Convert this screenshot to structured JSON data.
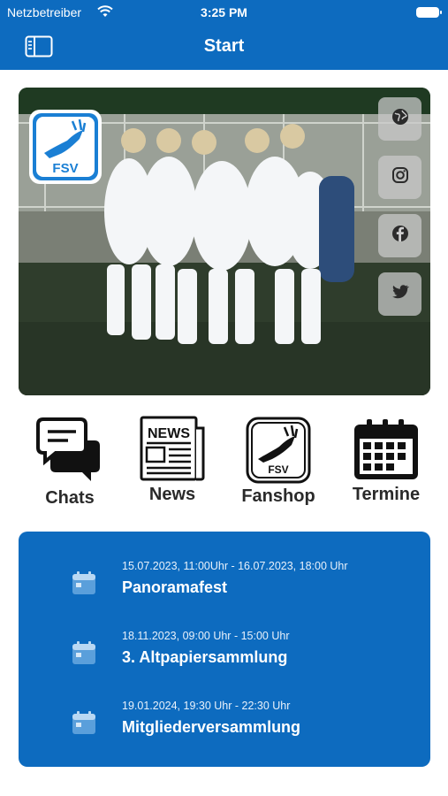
{
  "status": {
    "carrier": "Netzbetreiber",
    "time": "3:25 PM"
  },
  "nav": {
    "title": "Start"
  },
  "hero": {
    "logo_text": "FSV"
  },
  "tiles": [
    {
      "label": "Chats",
      "icon": "chat-icon"
    },
    {
      "label": "News",
      "icon": "newspaper-icon"
    },
    {
      "label": "Fanshop",
      "icon": "fsv-logo-icon"
    },
    {
      "label": "Termine",
      "icon": "calendar-icon"
    }
  ],
  "tile_icon_texts": {
    "news": "NEWS",
    "fanshop": "FSV"
  },
  "social": [
    "globe-icon",
    "instagram-icon",
    "facebook-icon",
    "twitter-icon"
  ],
  "events": [
    {
      "date": "15.07.2023, 11:00Uhr - 16.07.2023, 18:00 Uhr",
      "title": "Panoramafest"
    },
    {
      "date": "18.11.2023, 09:00 Uhr - 15:00 Uhr",
      "title": "3. Altpapiersammlung"
    },
    {
      "date": "19.01.2024, 19:30 Uhr - 22:30 Uhr",
      "title": "Mitgliederversammlung"
    }
  ],
  "colors": {
    "brand": "#0d6bbf",
    "background": "#ffffff"
  }
}
